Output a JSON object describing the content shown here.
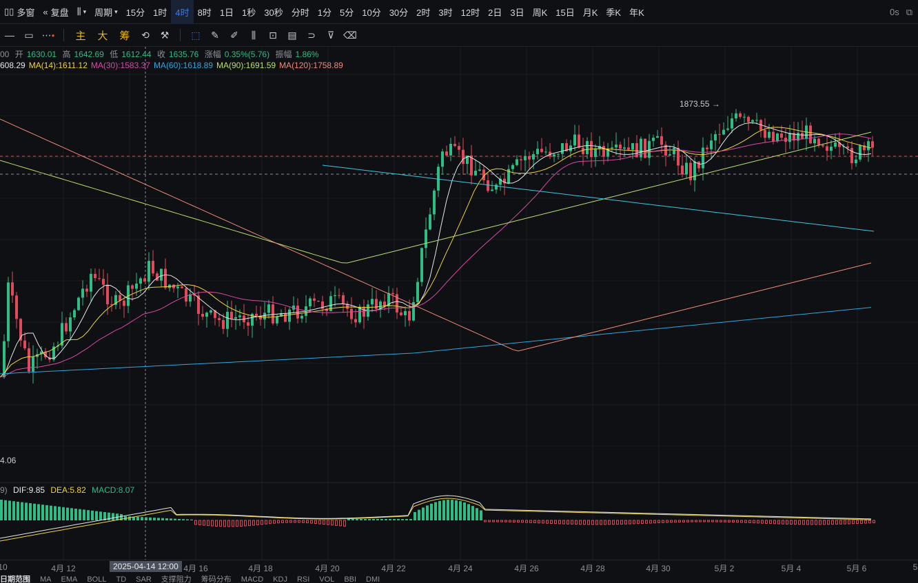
{
  "topbar": {
    "windows_label": "多窗",
    "replay_label": "复盘",
    "period_label": "周期",
    "intervals": [
      "15分",
      "1时",
      "4时",
      "8时",
      "1日",
      "1秒",
      "30秒",
      "分时",
      "1分",
      "5分",
      "10分",
      "30分",
      "2时",
      "3时",
      "12时",
      "2日",
      "3日",
      "周K",
      "15日",
      "月K",
      "季K",
      "年K"
    ],
    "active_interval": "4时",
    "right_text": "0s"
  },
  "toolbar": {
    "indicators": [
      "主",
      "大",
      "筹"
    ]
  },
  "ohlc": {
    "prefix": "00",
    "open_label": "开",
    "open": "1630.01",
    "high_label": "高",
    "high": "1642.69",
    "low_label": "低",
    "low": "1612.44",
    "close_label": "收",
    "close": "1635.76",
    "change_label": "涨幅",
    "change": "0.35%(5.76)",
    "amp_label": "振幅",
    "amp": "1.86%"
  },
  "ma": [
    {
      "text": "608.29",
      "color": "#e8e8e8"
    },
    {
      "text": "MA(14):1611.12",
      "color": "#f2d33a"
    },
    {
      "text": "MA(30):1583.37",
      "color": "#d94aa6"
    },
    {
      "text": "MA(60):1618.89",
      "color": "#2ea8e0"
    },
    {
      "text": "MA(90):1691.59",
      "color": "#b8e068"
    },
    {
      "text": "MA(120):1758.89",
      "color": "#f08a7a"
    }
  ],
  "annotations": {
    "high_marker": "1873.55 →",
    "low_label": "4.06"
  },
  "macd": {
    "prefix": "9)",
    "dif": "DIF:9.85",
    "dea": "DEA:5.82",
    "macd": "MACD:8.07",
    "colors": {
      "dif": "#e8e8e8",
      "dea": "#f2d33a",
      "macd": "#2ebd85"
    }
  },
  "xaxis": {
    "labels": [
      "10",
      "4月 12",
      "4月 16",
      "4月 18",
      "4月 20",
      "4月 22",
      "4月 24",
      "4月 26",
      "4月 28",
      "4月 30",
      "5月 2",
      "5月 4",
      "5月 6",
      "5"
    ],
    "crosshair_label": "2025-04-14 12:00"
  },
  "bottombar": {
    "items": [
      "日期范围",
      "MA",
      "EMA",
      "BOLL",
      "TD",
      "SAR",
      "支撑阻力",
      "筹码分布",
      "MACD",
      "KDJ",
      "RSI",
      "VOL",
      "BBI",
      "DMI"
    ]
  },
  "colors": {
    "up": "#2ebd85",
    "down": "#e04a5a",
    "accent": "#2f7cf6",
    "gold": "#e6b422"
  }
}
